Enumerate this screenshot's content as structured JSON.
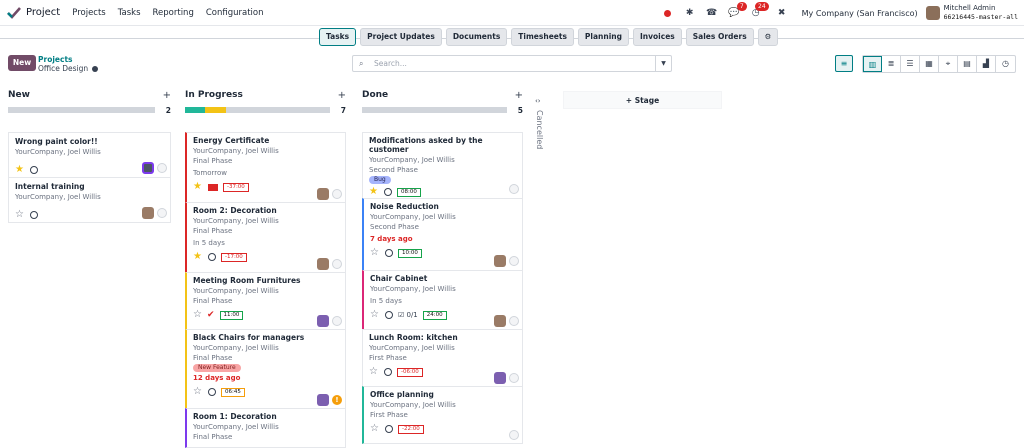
{
  "navbar": {
    "app_name": "Project",
    "menu": [
      "Projects",
      "Tasks",
      "Reporting",
      "Configuration"
    ],
    "badges": {
      "activity": "7",
      "messages": "24"
    },
    "company": "My Company (San Francisco)",
    "user_name": "Mitchell Admin",
    "db_name": "66216445-master-all"
  },
  "tabs": [
    "Tasks",
    "Project Updates",
    "Documents",
    "Timesheets",
    "Planning",
    "Invoices",
    "Sales Orders"
  ],
  "control": {
    "new_label": "New",
    "breadcrumb_parent": "Projects",
    "breadcrumb_current": "Office Design",
    "search_placeholder": "Search..."
  },
  "columns": [
    {
      "title": "New",
      "count": "2",
      "progress": [],
      "cards": [
        {
          "title": "Wrong paint color!!",
          "sub": "YourCompany, Joel Willis",
          "star": true
        },
        {
          "title": "Internal training",
          "sub": "YourCompany, Joel Willis",
          "star": false
        }
      ]
    },
    {
      "title": "In Progress",
      "count": "7",
      "progress": [
        {
          "color": "#21b799",
          "pct": 14
        },
        {
          "color": "#f3c316",
          "pct": 14
        }
      ],
      "cards": [
        {
          "title": "Energy Certificate",
          "sub": "YourCompany, Joel Willis",
          "stage": "Final Phase",
          "date": "Tomorrow",
          "time": "-37:00",
          "star": true
        },
        {
          "title": "Room 2: Decoration",
          "sub": "YourCompany, Joel Willis",
          "stage": "Final Phase",
          "date": "In 5 days",
          "time": "-17:00",
          "star": true
        },
        {
          "title": "Meeting Room Furnitures",
          "sub": "YourCompany, Joel Willis",
          "stage": "Final Phase",
          "time": "11:00",
          "star": false
        },
        {
          "title": "Black Chairs for managers",
          "sub": "YourCompany, Joel Willis",
          "stage": "Final Phase",
          "tag": "New Feature",
          "date": "12 days ago",
          "time": "06:45",
          "star": false
        },
        {
          "title": "Room 1: Decoration",
          "sub": "YourCompany, Joel Willis",
          "stage": "Final Phase"
        }
      ]
    },
    {
      "title": "Done",
      "count": "5",
      "progress": [],
      "cards": [
        {
          "title": "Modifications asked by the customer",
          "sub": "YourCompany, Joel Willis",
          "stage": "Second Phase",
          "tag": "Bug",
          "time": "08:00",
          "star": true
        },
        {
          "title": "Noise Reduction",
          "sub": "YourCompany, Joel Willis",
          "stage": "Second Phase",
          "date": "7 days ago",
          "time": "10:00",
          "star": false
        },
        {
          "title": "Chair Cabinet",
          "sub": "YourCompany, Joel Willis",
          "date": "In 5 days",
          "checklist": "0/1",
          "time": "24:00",
          "star": false
        },
        {
          "title": "Lunch Room: kitchen",
          "sub": "YourCompany, Joel Willis",
          "stage": "First Phase",
          "time": "-06:00",
          "star": false
        },
        {
          "title": "Office planning",
          "sub": "YourCompany, Joel Willis",
          "stage": "First Phase",
          "time": "-22:00",
          "star": false
        }
      ]
    }
  ],
  "folded_column": "Cancelled",
  "add_stage_label": "Stage"
}
